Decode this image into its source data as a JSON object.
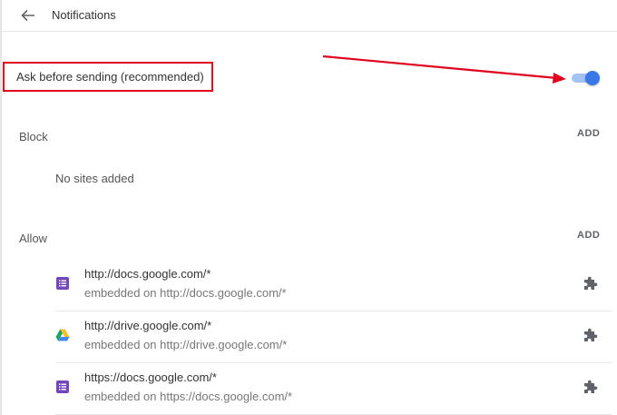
{
  "header": {
    "back_icon": "arrow-back-icon",
    "title": "Notifications"
  },
  "ask": {
    "label": "Ask before sending (recommended)",
    "toggle_on": true,
    "toggle_color": "#3b78e7"
  },
  "annotation": {
    "color": "#e1001e"
  },
  "block": {
    "label": "Block",
    "add_label": "ADD",
    "empty_text": "No sites added"
  },
  "allow": {
    "label": "Allow",
    "add_label": "ADD",
    "sites": [
      {
        "url": "http://docs.google.com/*",
        "embedded": "embedded on http://docs.google.com/*",
        "icon": "google-docs-icon",
        "action_icon": "extension-puzzle-icon"
      },
      {
        "url": "http://drive.google.com/*",
        "embedded": "embedded on http://drive.google.com/*",
        "icon": "google-drive-icon",
        "action_icon": "extension-puzzle-icon"
      },
      {
        "url": "https://docs.google.com/*",
        "embedded": "embedded on https://docs.google.com/*",
        "icon": "google-docs-icon",
        "action_icon": "extension-puzzle-icon"
      }
    ]
  }
}
